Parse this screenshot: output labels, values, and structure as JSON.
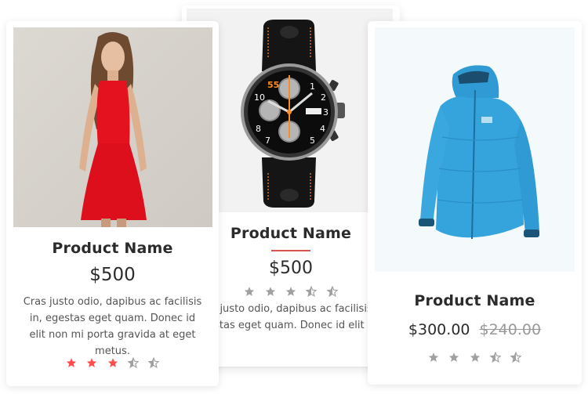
{
  "colors": {
    "accent_red": "#ff4d4d",
    "star_gray": "#a0a0a0",
    "divider_red": "#d9534f"
  },
  "products": [
    {
      "image": "woman-in-red-dress-photo",
      "name": "Product Name",
      "price": "$500",
      "description": "Cras justo odio, dapibus ac facilisis in, egestas eget quam. Donec id elit non mi porta gravida at eget metus.",
      "rating": {
        "filled": 3,
        "half": 2,
        "max": 5,
        "color": "red"
      }
    },
    {
      "image": "black-chronograph-watch-photo",
      "name": "Product Name",
      "price": "$500",
      "description": "Cras justo odio, dapibus ac facilisis in, egestas eget quam. Donec id elit non",
      "rating": {
        "filled": 3,
        "half": 2,
        "max": 5,
        "color": "gray"
      }
    },
    {
      "image": "blue-down-jacket-photo",
      "name": "Product Name",
      "price": "$300.00",
      "old_price": "$240.00",
      "rating": {
        "filled": 3,
        "half": 2,
        "max": 5,
        "color": "gray"
      }
    }
  ]
}
